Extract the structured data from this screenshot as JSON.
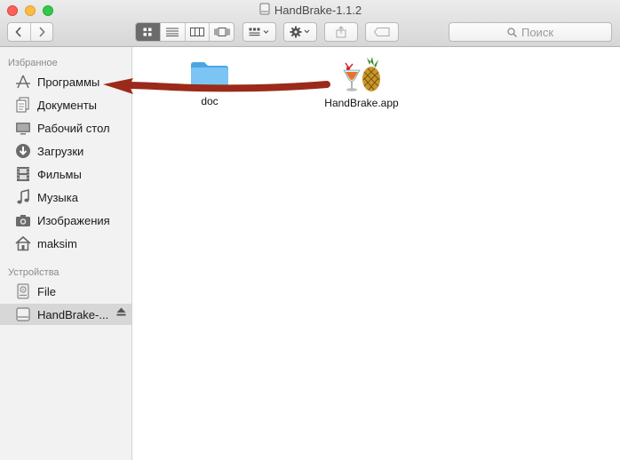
{
  "window": {
    "title": "HandBrake-1.1.2"
  },
  "toolbar": {
    "back_icon": "chevron-left-icon",
    "forward_icon": "chevron-right-icon",
    "view_modes": [
      "icon-view-icon",
      "list-view-icon",
      "column-view-icon",
      "cover-flow-icon"
    ],
    "active_view": "icon-view-icon",
    "search_placeholder": "Поиск"
  },
  "sidebar": {
    "favorites_heading": "Избранное",
    "favorites": [
      {
        "label": "Программы",
        "icon": "applications-icon"
      },
      {
        "label": "Документы",
        "icon": "documents-icon"
      },
      {
        "label": "Рабочий стол",
        "icon": "desktop-icon"
      },
      {
        "label": "Загрузки",
        "icon": "downloads-icon"
      },
      {
        "label": "Фильмы",
        "icon": "movies-icon"
      },
      {
        "label": "Музыка",
        "icon": "music-icon"
      },
      {
        "label": "Изображения",
        "icon": "pictures-icon"
      },
      {
        "label": "maksim",
        "icon": "home-icon"
      }
    ],
    "devices_heading": "Устройства",
    "devices": [
      {
        "label": "File",
        "icon": "disk-icon"
      },
      {
        "label": "HandBrake-...",
        "icon": "drive-icon",
        "selected": true
      }
    ]
  },
  "content": {
    "items": [
      {
        "name": "doc",
        "icon": "folder-icon"
      },
      {
        "name": "HandBrake.app",
        "icon": "handbrake-app-icon"
      }
    ]
  },
  "colors": {
    "arrow": "#9b2a1a",
    "folder": "#5eb8ee",
    "selection": "#d7d7d7"
  }
}
